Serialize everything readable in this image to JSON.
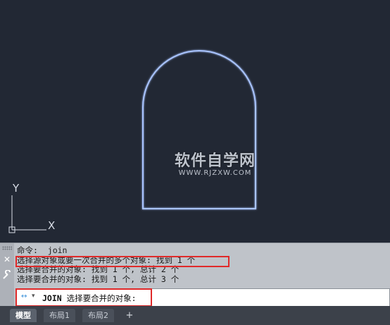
{
  "canvas": {
    "ucs": {
      "y_label": "Y",
      "x_label": "X"
    },
    "watermark": {
      "title": "软件自学网",
      "url": "WWW.RJZXW.COM"
    }
  },
  "command_panel": {
    "close_icon": "close-icon",
    "settings_icon": "wrench-icon",
    "history": [
      "命令:  join",
      "选择源对象或要一次合并的多个对象: 找到 1 个",
      "选择要合并的对象: 找到 1 个, 总计 2 个",
      "选择要合并的对象: 找到 1 个, 总计 3 个"
    ],
    "input": {
      "command": "JOIN",
      "prompt": "选择要合并的对象:"
    }
  },
  "tabs": {
    "items": [
      "模型",
      "布局1",
      "布局2"
    ],
    "active": "模型",
    "add_label": "+"
  }
}
